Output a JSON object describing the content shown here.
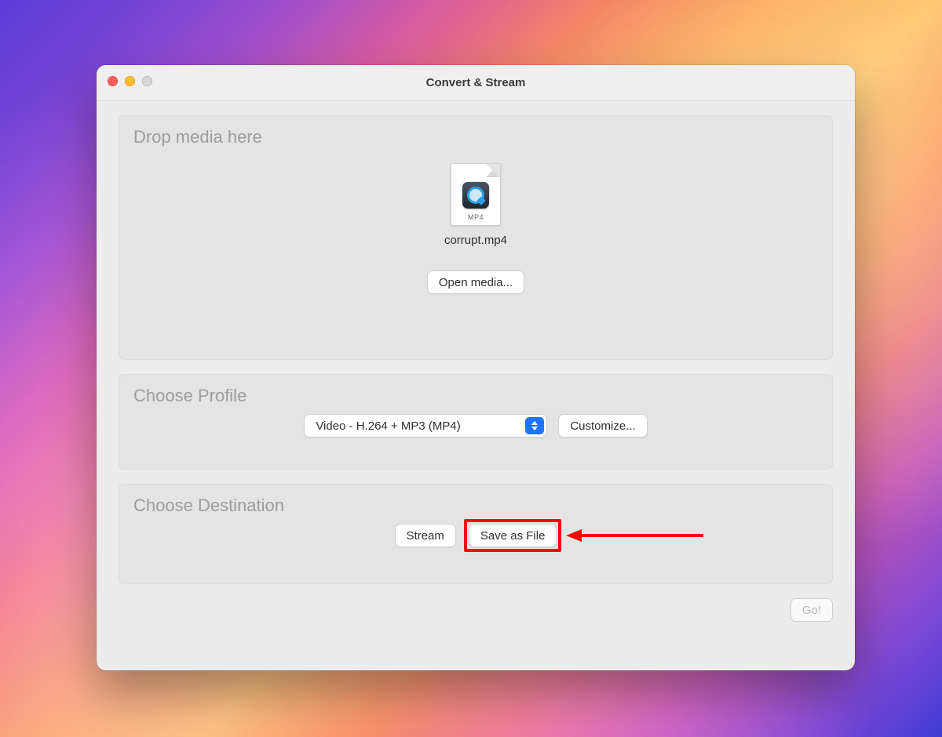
{
  "window": {
    "title": "Convert & Stream"
  },
  "drop": {
    "heading": "Drop media here",
    "file_ext": "MP4",
    "file_name": "corrupt.mp4",
    "open_button": "Open media..."
  },
  "profile": {
    "heading": "Choose Profile",
    "selected": "Video - H.264 + MP3 (MP4)",
    "customize_button": "Customize..."
  },
  "destination": {
    "heading": "Choose Destination",
    "stream_button": "Stream",
    "save_button": "Save as File"
  },
  "footer": {
    "go_button": "Go!"
  }
}
